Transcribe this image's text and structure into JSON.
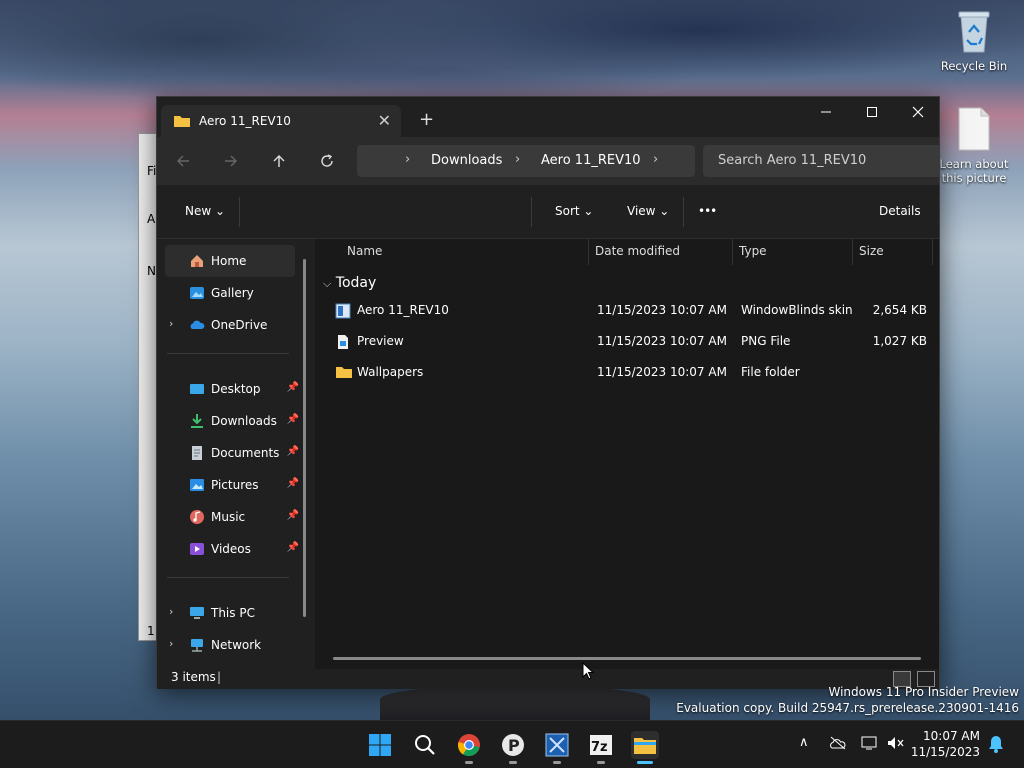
{
  "desktop": {
    "icons": [
      {
        "label": "Recycle Bin",
        "icon": "recycle-bin-icon"
      },
      {
        "label": "Learn about this picture",
        "icon": "document-icon"
      }
    ],
    "watermark": {
      "line1": "Windows 11 Pro Insider Preview",
      "line2": "Evaluation copy. Build 25947.rs_prerelease.230901-1416"
    },
    "background_window": {
      "letters": [
        "Fi",
        "A",
        "N",
        "1 /"
      ]
    }
  },
  "explorer": {
    "tab": {
      "title": "Aero 11_REV10",
      "close": "✕"
    },
    "new_tab": "+",
    "breadcrumb": [
      "Downloads",
      "Aero 11_REV10"
    ],
    "search_placeholder": "Search Aero 11_REV10",
    "commands": {
      "new": "New",
      "sort": "Sort",
      "view": "View",
      "more": "•••",
      "details": "Details"
    },
    "nav": {
      "home": "Home",
      "gallery": "Gallery",
      "onedrive": "OneDrive",
      "desktop": "Desktop",
      "downloads": "Downloads",
      "documents": "Documents",
      "pictures": "Pictures",
      "music": "Music",
      "videos": "Videos",
      "this_pc": "This PC",
      "network": "Network"
    },
    "columns": {
      "name": "Name",
      "date": "Date modified",
      "type": "Type",
      "size": "Size"
    },
    "group": "Today",
    "files": [
      {
        "name": "Aero 11_REV10",
        "date": "11/15/2023 10:07 AM",
        "type": "WindowBlinds skin",
        "size": "2,654 KB"
      },
      {
        "name": "Preview",
        "date": "11/15/2023 10:07 AM",
        "type": "PNG File",
        "size": "1,027 KB"
      },
      {
        "name": "Wallpapers",
        "date": "11/15/2023 10:07 AM",
        "type": "File folder",
        "size": ""
      }
    ],
    "status": "3 items"
  },
  "taskbar": {
    "time": "10:07 AM",
    "date": "11/15/2023"
  },
  "colors": {
    "accent": "#0078d4",
    "folder": "#f4c142",
    "window_bg": "#191919"
  }
}
